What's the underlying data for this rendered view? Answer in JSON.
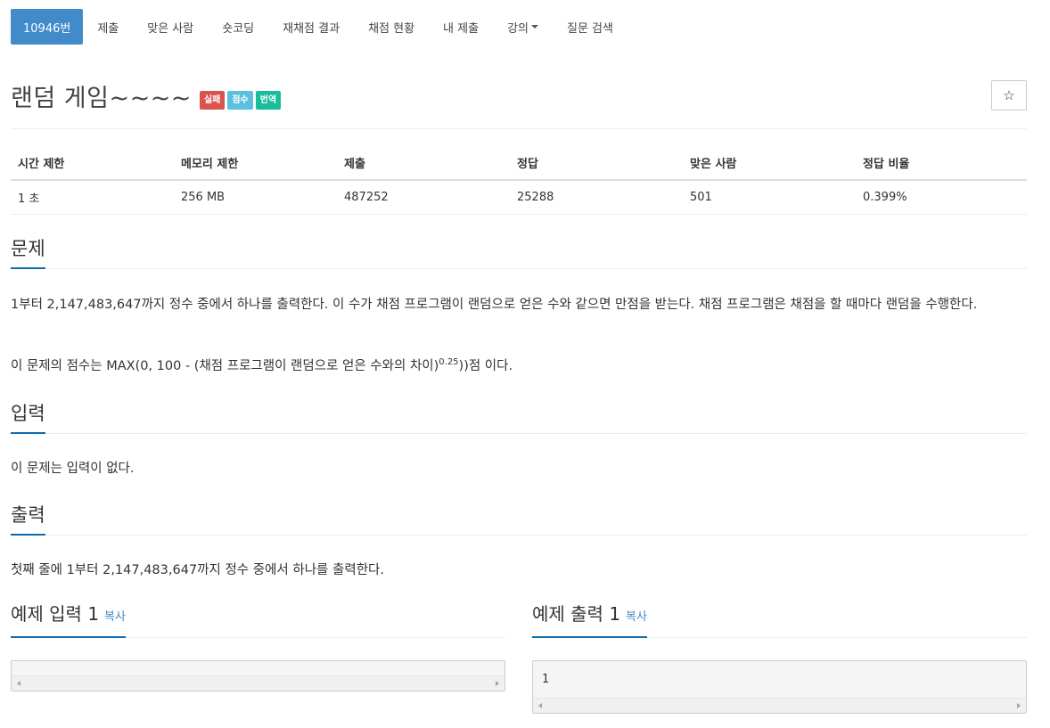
{
  "nav": {
    "items": [
      {
        "label": "10946번",
        "active": true
      },
      {
        "label": "제출"
      },
      {
        "label": "맞은 사람"
      },
      {
        "label": "숏코딩"
      },
      {
        "label": "재채점 결과"
      },
      {
        "label": "채점 현황"
      },
      {
        "label": "내 제출"
      },
      {
        "label": "강의",
        "dropdown": true
      },
      {
        "label": "질문 검색"
      }
    ]
  },
  "problem": {
    "title": "랜덤 게임~~~~",
    "badges": [
      {
        "label": "실패",
        "color": "#d9534f"
      },
      {
        "label": "점수",
        "color": "#5bc0de"
      },
      {
        "label": "번역",
        "color": "#1abc9c"
      }
    ],
    "star_icon": "☆"
  },
  "info": {
    "headers": [
      "시간 제한",
      "메모리 제한",
      "제출",
      "정답",
      "맞은 사람",
      "정답 비율"
    ],
    "values": [
      "1 초",
      "256 MB",
      "487252",
      "25288",
      "501",
      "0.399%"
    ]
  },
  "sections": {
    "problem": {
      "heading": "문제",
      "para1": "1부터 2,147,483,647까지 정수 중에서 하나를 출력한다. 이 수가 채점 프로그램이 랜덤으로 얻은 수와 같으면 만점을 받는다. 채점 프로그램은 채점을 할 때마다 랜덤을 수행한다.",
      "para2_before": "이 문제의 점수는 MAX(0, 100 - (채점 프로그램이 랜덤으로 얻은 수와의 차이)",
      "para2_sup": "0.25",
      "para2_after": "))점 이다."
    },
    "input": {
      "heading": "입력",
      "text": "이 문제는 입력이 없다."
    },
    "output": {
      "heading": "출력",
      "text": "첫째 줄에 1부터 2,147,483,647까지 정수 중에서 하나를 출력한다."
    }
  },
  "samples": {
    "input": {
      "heading": "예제 입력 1",
      "copy": "복사",
      "content": ""
    },
    "output": {
      "heading": "예제 출력 1",
      "copy": "복사",
      "content": "1"
    }
  },
  "colors": {
    "accent": "#428bca",
    "section_underline": "#0d6aad"
  }
}
